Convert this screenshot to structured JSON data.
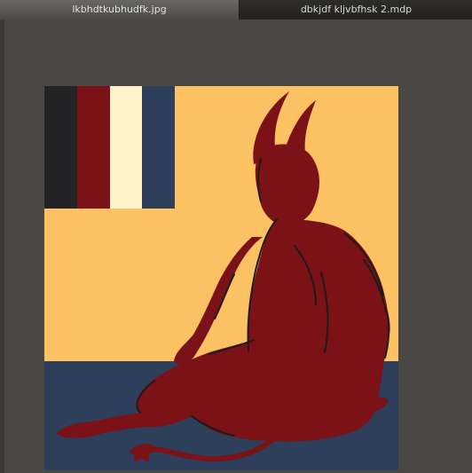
{
  "tabs": [
    {
      "label": "lkbhdtkubhudfk.jpg",
      "active": true
    },
    {
      "label": "dbkjdf kljvbfhsk 2.mdp",
      "active": false
    }
  ],
  "palette": [
    "#232326",
    "#7a1218",
    "#fff3c9",
    "#2d3f5a"
  ],
  "colors": {
    "background": "#fbc162",
    "floor": "#2d3f5a",
    "figure": "#7a1218",
    "outline": "#1f1b1b"
  }
}
